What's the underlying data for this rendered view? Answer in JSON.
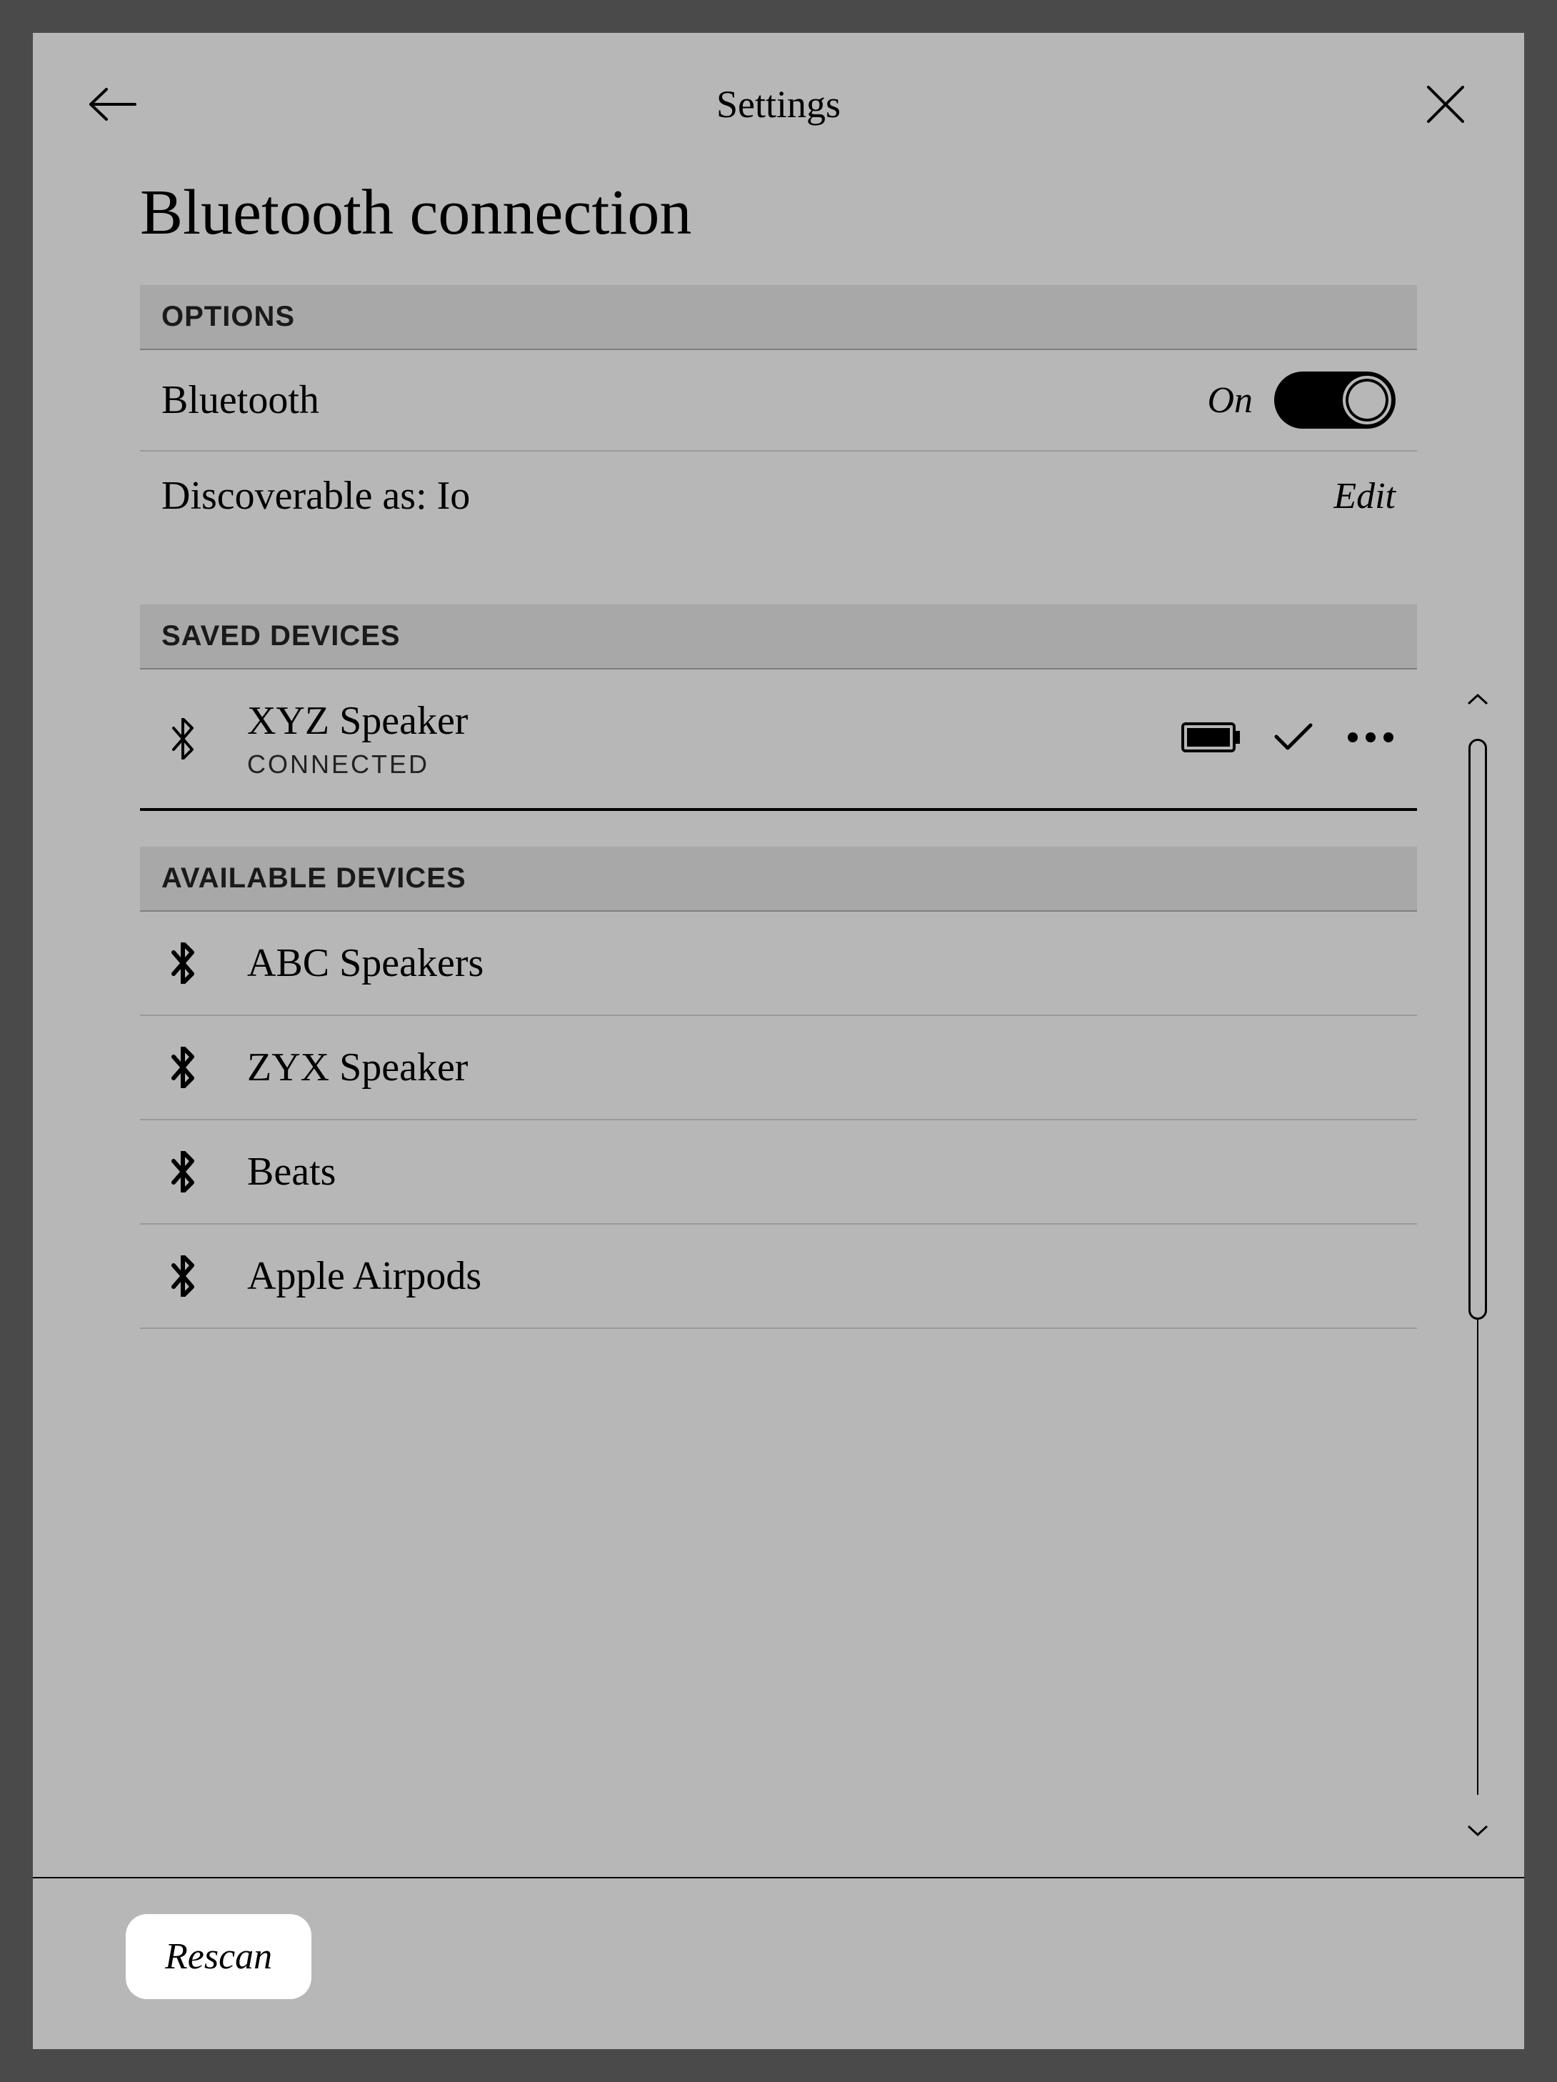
{
  "titlebar": {
    "title": "Settings"
  },
  "page_title": "Bluetooth connection",
  "sections": {
    "options_header": "OPTIONS",
    "saved_header": "SAVED DEVICES",
    "available_header": "AVAILABLE DEVICES"
  },
  "options": {
    "bluetooth_label": "Bluetooth",
    "bluetooth_state": "On",
    "discoverable_label": "Discoverable as: Io",
    "edit_label": "Edit"
  },
  "saved_devices": [
    {
      "name": "XYZ Speaker",
      "status": "CONNECTED"
    }
  ],
  "available_devices": [
    {
      "name": "ABC Speakers"
    },
    {
      "name": "ZYX Speaker"
    },
    {
      "name": "Beats"
    },
    {
      "name": "Apple Airpods"
    }
  ],
  "footer": {
    "rescan_label": "Rescan"
  }
}
